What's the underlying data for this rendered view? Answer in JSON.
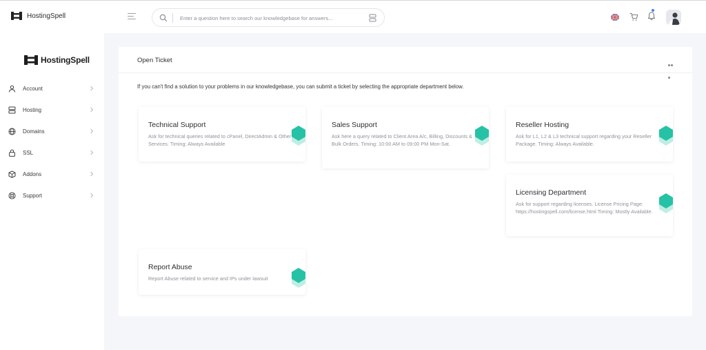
{
  "app": {
    "brand_name": "HostingSpell",
    "sidebar_logo_text": "HostingSpell"
  },
  "search": {
    "placeholder": "Enter a question here to search our knowledgebase for answers..."
  },
  "sidebar": {
    "items": [
      {
        "label": "Account",
        "icon": "user-icon"
      },
      {
        "label": "Hosting",
        "icon": "server-icon"
      },
      {
        "label": "Domains",
        "icon": "globe-icon"
      },
      {
        "label": "SSL",
        "icon": "lock-icon"
      },
      {
        "label": "Addons",
        "icon": "box-icon"
      },
      {
        "label": "Support",
        "icon": "lifebuoy-icon"
      }
    ]
  },
  "main": {
    "title": "Open Ticket",
    "intro": "If you can't find a solution to your problems in our knowledgebase, you can submit a ticket by selecting the appropriate department below.",
    "departments": [
      {
        "title": "Technical Support",
        "description": "Ask for technical queries related to cPanel, DirectAdmin & Other Services. Timing: Always Available"
      },
      {
        "title": "Sales Support",
        "description": "Ask here a query related to Client Area A/c, Billing, Discounts & Bulk Orders. Timing: 10:00 AM to 09:00 PM Mon-Sat."
      },
      {
        "title": "Reseller Hosting",
        "description": "Ask for L1, L2 & L3 technical support regarding your Reseller Package. Timing: Always Available."
      },
      {
        "title": "Licensing Department",
        "description": "Ask for support regarding licenses. License Pricing Page: https://hostingspell.com/license.html Timing: Mostly Available."
      },
      {
        "title": "Report Abuse",
        "description": "Report Abuse related to service and IPs under lawsuit"
      }
    ]
  },
  "colors": {
    "accent": "#26c2a6",
    "accent_light": "#bfeee4",
    "notification_dot": "#4a7cf6",
    "background": "#f5f6fa"
  }
}
